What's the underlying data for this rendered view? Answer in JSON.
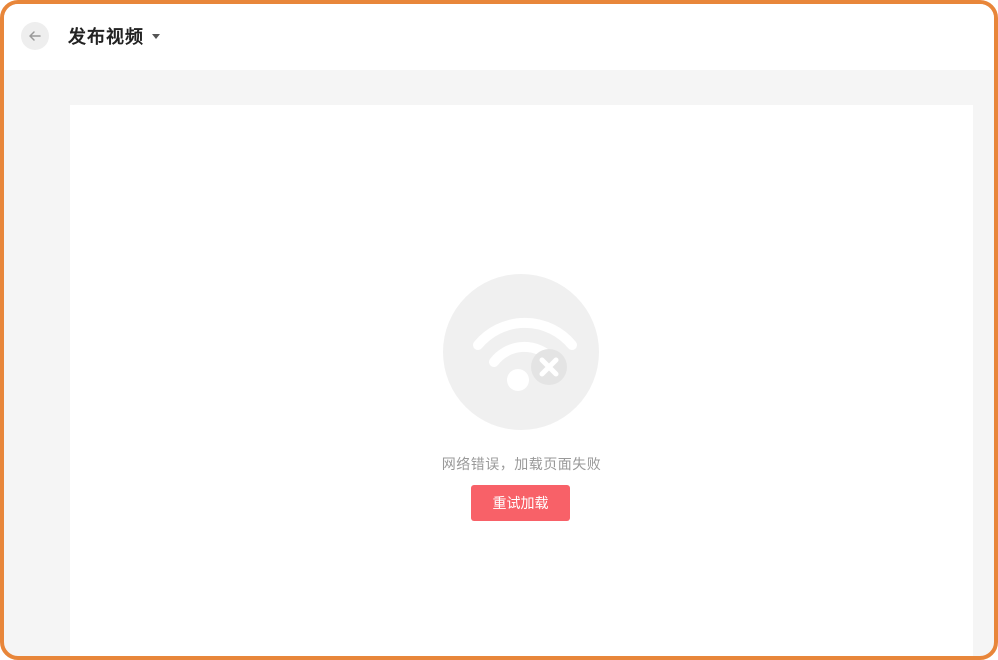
{
  "header": {
    "title": "发布视频",
    "back_icon": "arrow-left-icon",
    "dropdown_icon": "caret-down-icon"
  },
  "error": {
    "icon": "wifi-off-icon",
    "message": "网络错误，加载页面失败",
    "retry_label": "重试加载"
  },
  "colors": {
    "frame_border": "#e8863a",
    "retry_button": "#f86168",
    "background": "#f5f5f5"
  }
}
